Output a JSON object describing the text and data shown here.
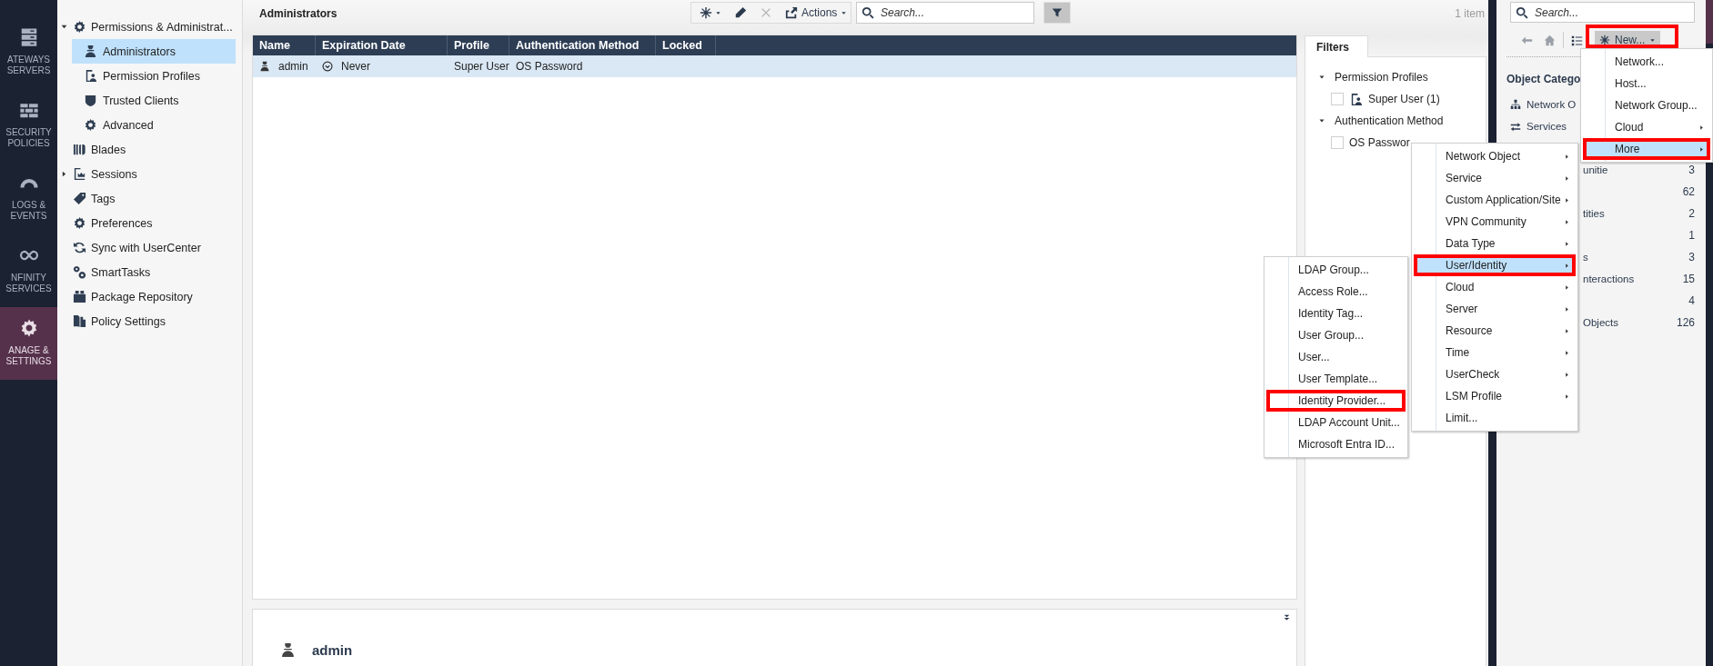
{
  "nav": [
    {
      "lines": [
        "ATEWAYS",
        "SERVERS"
      ],
      "selected": false
    },
    {
      "lines": [
        "SECURITY",
        "POLICIES"
      ],
      "selected": false
    },
    {
      "lines": [
        "LOGS &",
        "EVENTS"
      ],
      "selected": false
    },
    {
      "lines": [
        "NFINITY",
        "SERVICES"
      ],
      "selected": false
    },
    {
      "lines": [
        "ANAGE &",
        "SETTINGS"
      ],
      "selected": true
    }
  ],
  "tree": [
    {
      "label": "Permissions & Administrat...",
      "expanded": true,
      "selected": false,
      "children": [
        {
          "label": "Administrators",
          "selected": true
        },
        {
          "label": "Permission Profiles",
          "selected": false
        },
        {
          "label": "Trusted Clients",
          "selected": false
        },
        {
          "label": "Advanced",
          "selected": false
        }
      ]
    },
    {
      "label": "Blades",
      "selected": false
    },
    {
      "label": "Sessions",
      "expanded": false,
      "selected": false
    },
    {
      "label": "Tags",
      "selected": false
    },
    {
      "label": "Preferences",
      "selected": false
    },
    {
      "label": "Sync with UserCenter",
      "selected": false
    },
    {
      "label": "SmartTasks",
      "selected": false
    },
    {
      "label": "Package Repository",
      "selected": false
    },
    {
      "label": "Policy Settings",
      "selected": false
    }
  ],
  "page_title": "Administrators",
  "toolbar": {
    "actions": "Actions",
    "delete_disabled": true,
    "search": {
      "placeholder": "Search..."
    },
    "filter_on": true
  },
  "item_count": "1 item",
  "table": {
    "columns": [
      "Name",
      "Expiration Date",
      "Profile",
      "Authentication Method",
      "Locked"
    ],
    "rows": [
      {
        "cells": [
          "admin",
          "Never",
          "Super User",
          "OS Password"
        ],
        "selected": true
      }
    ]
  },
  "filters": {
    "tab": "Filters",
    "groups": [
      {
        "label": "Permission Profiles",
        "expanded": true,
        "items": [
          {
            "label": "Super User (1)",
            "checked": false
          }
        ]
      },
      {
        "label": "Authentication Method",
        "expanded": true,
        "items": [
          {
            "label": "OS Passwor",
            "checked": false
          }
        ]
      }
    ]
  },
  "details": {
    "name": "admin"
  },
  "objects": {
    "search": {
      "placeholder": "Search..."
    },
    "new_button": {
      "label": "New...",
      "highlight": true
    },
    "heading": "Object Catego",
    "rows": [
      {
        "kind": "full",
        "label": "Network O"
      },
      {
        "kind": "full",
        "label": "Services"
      },
      {
        "kind": "partial",
        "label": "unitie",
        "count": "3"
      },
      {
        "kind": "partial",
        "count": "62"
      },
      {
        "kind": "partial",
        "label": "tities",
        "count": "2"
      },
      {
        "kind": "partial",
        "count": "1"
      },
      {
        "kind": "partial",
        "label": "s",
        "count": "3"
      },
      {
        "kind": "partial",
        "label": "nteractions",
        "count": "15"
      },
      {
        "kind": "partial",
        "count": "4"
      },
      {
        "kind": "partial",
        "label": "Objects",
        "count": "126"
      }
    ]
  },
  "new_menu": [
    {
      "label": "Network...",
      "submenu": false,
      "selected": false
    },
    {
      "label": "Host...",
      "submenu": false,
      "selected": false
    },
    {
      "label": "Network Group...",
      "submenu": false,
      "selected": false
    },
    {
      "label": "Cloud",
      "submenu": true,
      "selected": false
    },
    {
      "label": "More",
      "submenu": true,
      "selected": true,
      "highlight": true
    }
  ],
  "more_menu": [
    {
      "label": "Network Object",
      "submenu": true,
      "selected": false
    },
    {
      "label": "Service",
      "submenu": true,
      "selected": false
    },
    {
      "label": "Custom Application/Site",
      "submenu": true,
      "selected": false
    },
    {
      "label": "VPN Community",
      "submenu": true,
      "selected": false
    },
    {
      "label": "Data Type",
      "submenu": true,
      "selected": false
    },
    {
      "label": "User/Identity",
      "submenu": true,
      "selected": true,
      "highlight": true
    },
    {
      "label": "Cloud",
      "submenu": true,
      "selected": false
    },
    {
      "label": "Server",
      "submenu": true,
      "selected": false
    },
    {
      "label": "Resource",
      "submenu": true,
      "selected": false
    },
    {
      "label": "Time",
      "submenu": true,
      "selected": false
    },
    {
      "label": "UserCheck",
      "submenu": true,
      "selected": false
    },
    {
      "label": "LSM Profile",
      "submenu": true,
      "selected": false
    },
    {
      "label": "Limit...",
      "submenu": false,
      "selected": false
    }
  ],
  "user_menu": [
    {
      "label": "LDAP Group...",
      "selected": false
    },
    {
      "label": "Access Role...",
      "selected": false
    },
    {
      "label": "Identity Tag...",
      "selected": false
    },
    {
      "label": "User Group...",
      "selected": false
    },
    {
      "label": "User...",
      "selected": false
    },
    {
      "label": "User Template...",
      "selected": false
    },
    {
      "label": "Identity Provider...",
      "selected": false,
      "highlight": true
    },
    {
      "label": "LDAP Account Unit...",
      "selected": false
    },
    {
      "label": "Microsoft Entra ID...",
      "selected": false
    }
  ]
}
